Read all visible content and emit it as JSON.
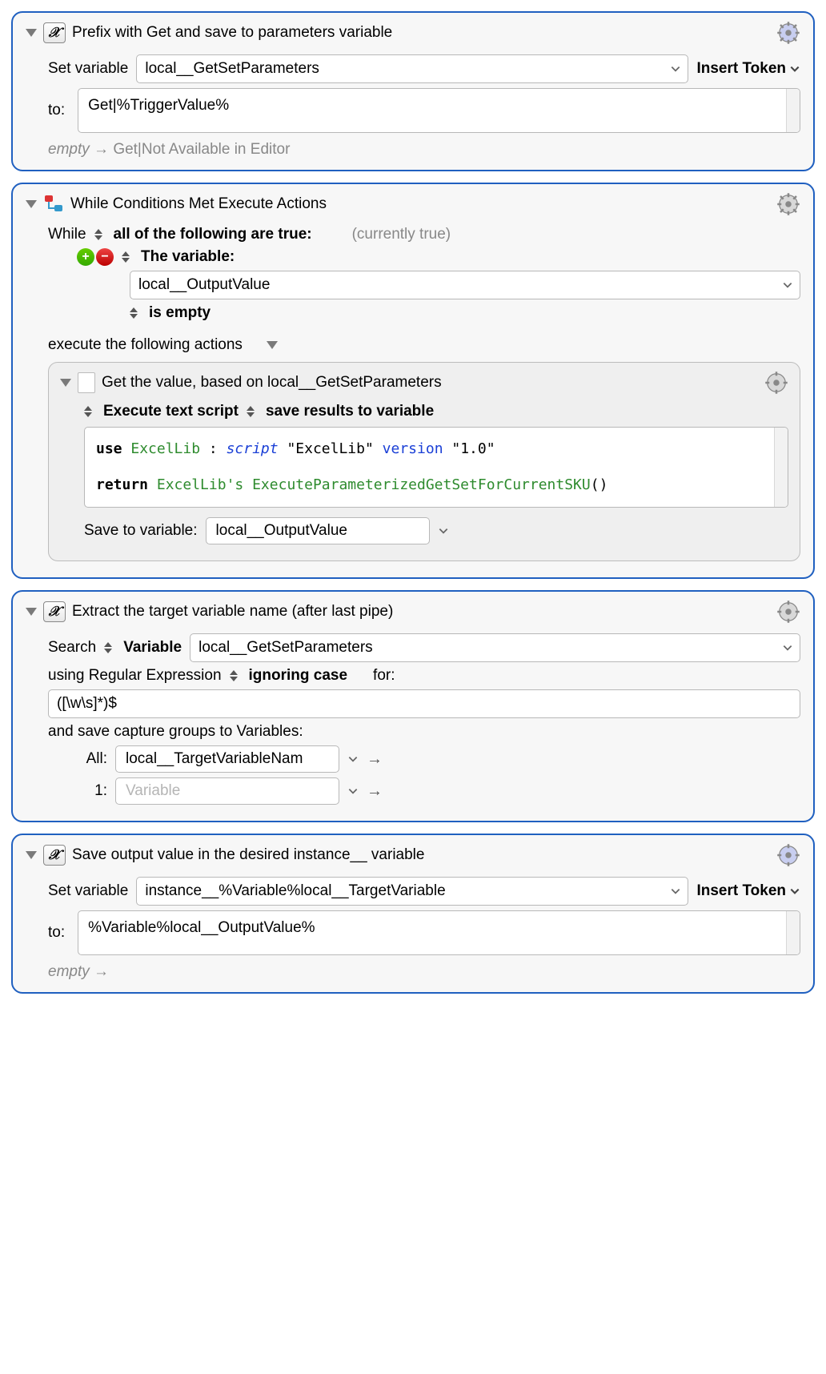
{
  "block1": {
    "title": "Prefix with Get and save to parameters variable",
    "setVariableLabel": "Set variable",
    "variableName": "local__GetSetParameters",
    "insertTokenLabel": "Insert Token",
    "toLabel": "to:",
    "toValue": "Get|%TriggerValue%",
    "emptyHintPrefix": "empty",
    "emptyHintArrow": " → ",
    "emptyHintValue": "Get|Not Available in Editor"
  },
  "block2": {
    "title": "While Conditions Met Execute Actions",
    "whileLabel": "While",
    "allFollowing": "all of the following are true:",
    "currentlyTrue": "(currently true)",
    "theVariable": "The variable:",
    "variableName": "local__OutputValue",
    "isEmpty": "is empty",
    "executeLabel": "execute the following actions",
    "nested": {
      "title": "Get the value, based on local__GetSetParameters",
      "executeScript": "Execute text script",
      "saveResults": "save results to variable",
      "code": {
        "use": "use",
        "excellib1": "ExcelLib",
        "colon": " : ",
        "script": "script",
        "excellibStr": "\"ExcelLib\"",
        "version": "version",
        "versionStr": "\"1.0\"",
        "return": "return",
        "excellib2": "ExcelLib's",
        "method": "ExecuteParameterizedGetSetForCurrentSKU",
        "parens": "()"
      },
      "saveToLabel": "Save to variable:",
      "saveToVar": "local__OutputValue"
    }
  },
  "block3": {
    "title": "Extract the target variable name (after last pipe)",
    "searchLabel": "Search",
    "variableWord": "Variable",
    "searchVarName": "local__GetSetParameters",
    "usingRegex": "using Regular Expression",
    "ignoringCase": "ignoring case",
    "forLabel": "for:",
    "regexPattern": "([\\w\\s]*)$",
    "saveCaptures": "and save capture groups to Variables:",
    "allLabel": "All:",
    "allValue": "local__TargetVariableNam",
    "oneLabel": "1:",
    "onePlaceholder": "Variable"
  },
  "block4": {
    "title": "Save output value in the desired instance__ variable",
    "setVariableLabel": "Set variable",
    "variableName": "instance__%Variable%local__TargetVariable",
    "insertTokenLabel": "Insert Token",
    "toLabel": "to:",
    "toValue": "%Variable%local__OutputValue%",
    "emptyHintPrefix": "empty",
    "emptyHintArrow": " →"
  }
}
